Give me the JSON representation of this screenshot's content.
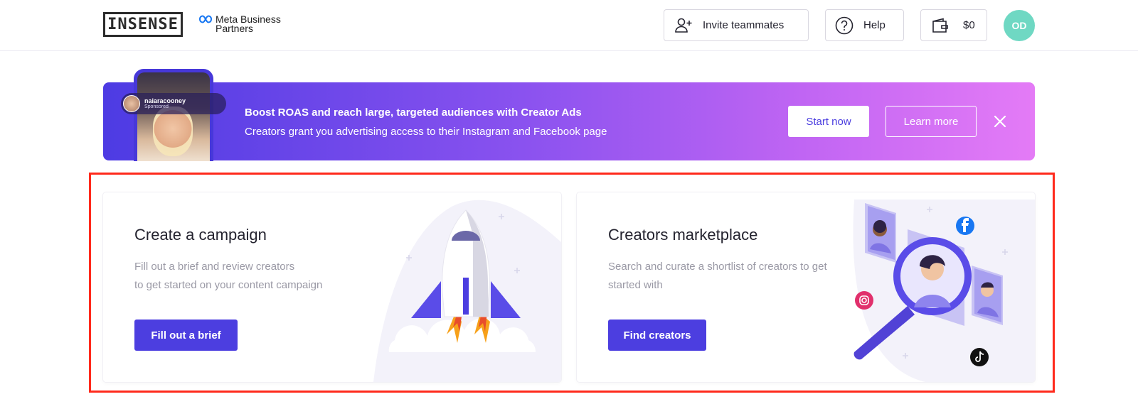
{
  "header": {
    "logo": "INSENSE",
    "meta_line1": "Meta Business",
    "meta_line2": "Partners",
    "invite_label": "Invite teammates",
    "help_label": "Help",
    "balance": "$0",
    "avatar_initials": "OD"
  },
  "banner": {
    "profile_name": "naiaracooney",
    "profile_sub": "Sponsored",
    "title": "Boost ROAS and reach large, targeted audiences with Creator Ads",
    "subtitle": "Creators grant you advertising access to their Instagram and Facebook page",
    "start_label": "Start now",
    "learn_label": "Learn more"
  },
  "cards": {
    "campaign": {
      "title": "Create a campaign",
      "desc_line1": "Fill out a brief and review creators",
      "desc_line2": "to get started on your content campaign",
      "button": "Fill out a brief"
    },
    "marketplace": {
      "title": "Creators marketplace",
      "desc_line1": "Search and curate a shortlist of creators to get",
      "desc_line2": "started with",
      "button": "Find creators"
    }
  },
  "colors": {
    "accent": "#4c3ee0",
    "highlight": "#ff2a1c",
    "avatar": "#6fd8c3"
  }
}
